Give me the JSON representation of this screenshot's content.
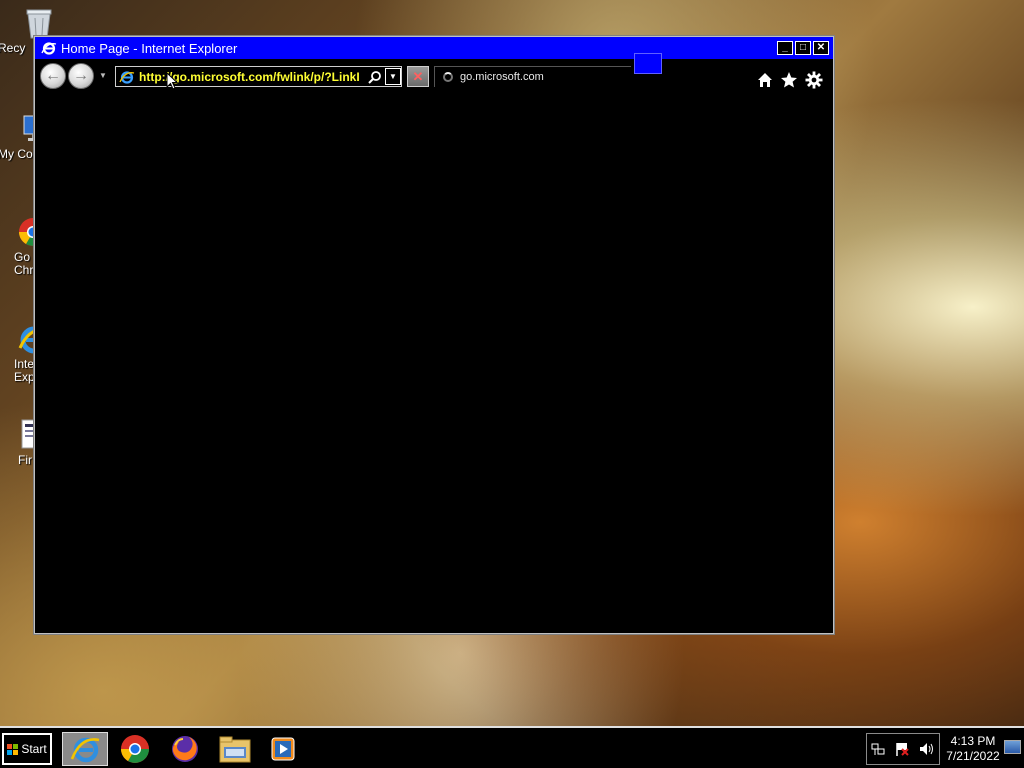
{
  "desktop": {
    "icons": [
      {
        "name": "recycle-bin",
        "label": "Recy"
      },
      {
        "name": "my-computer",
        "label": "My Co"
      },
      {
        "name": "google-chrome",
        "label": "Go\nChr"
      },
      {
        "name": "internet-explorer",
        "label": "Inte\nExp"
      },
      {
        "name": "firefox",
        "label": "Fir"
      }
    ]
  },
  "window": {
    "title": "Home Page - Internet Explorer",
    "buttons": {
      "minimize": "_",
      "maximize": "□",
      "close": "✕"
    }
  },
  "toolbar": {
    "address_value": "http://go.microsoft.com/fwlink/p/?LinkI",
    "tab_title": "go.microsoft.com",
    "icons": [
      "back-icon",
      "forward-icon",
      "search-icon",
      "home-icon",
      "favorites-icon",
      "settings-icon"
    ]
  },
  "taskbar": {
    "start_label": "Start",
    "apps": [
      "internet-explorer",
      "chrome",
      "firefox",
      "file-explorer",
      "media-player"
    ],
    "clock": {
      "time": "4:13 PM",
      "date": "7/21/2022"
    }
  },
  "colors": {
    "title_bar": "#0000ff",
    "address_text": "#ffff33",
    "window_bg": "#000000"
  }
}
